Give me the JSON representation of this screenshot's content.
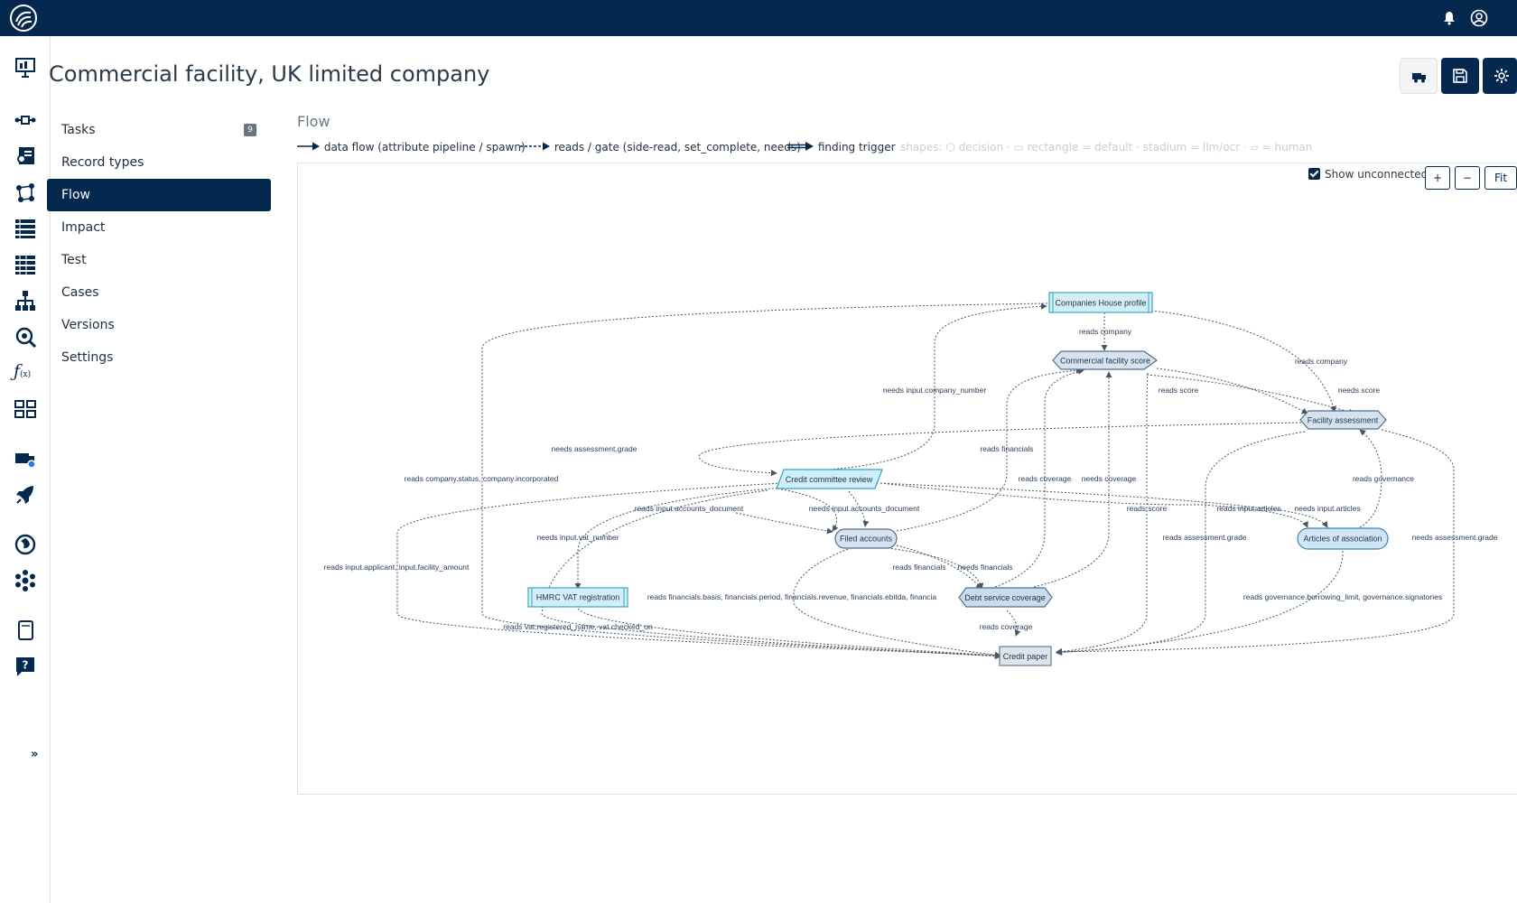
{
  "header": {
    "notifications_icon": "bell-icon",
    "user_icon": "user-circle-icon"
  },
  "rail": {
    "items": [
      "presentation-icon",
      "pipeline-icon",
      "contact-card-icon",
      "workflow-icon",
      "list-icon",
      "list-alt-icon",
      "hierarchy-icon",
      "inspect-icon",
      "function-icon",
      "table-icon",
      "truck-icon",
      "rocket-icon",
      "globe-icon",
      "network-icon",
      "document-icon",
      "help-icon"
    ],
    "expand_label": "»"
  },
  "page": {
    "title": "Commercial facility, UK limited company"
  },
  "toolbar": {
    "buttons": [
      "truck-icon",
      "save-icon",
      "gear-icon"
    ]
  },
  "nav": {
    "items": [
      {
        "label": "Tasks",
        "count": "9"
      },
      {
        "label": "Record types"
      },
      {
        "label": "Flow",
        "active": true
      },
      {
        "label": "Impact"
      },
      {
        "label": "Test"
      },
      {
        "label": "Cases"
      },
      {
        "label": "Versions"
      },
      {
        "label": "Settings"
      }
    ]
  },
  "flow": {
    "title": "Flow",
    "legend": {
      "data_flow": "data flow (attribute pipeline / spawn)",
      "reads_gate": "reads / gate (side-read, set_complete, needs)",
      "finding_trigger": "finding trigger",
      "shapes": "shapes: ⬡ decision · ▭ rectangle = default · stadium = llm/ocr · ▱ = human"
    },
    "show_unconnected": "Show unconnected",
    "zoom_in": "+",
    "zoom_out": "−",
    "fit": "Fit",
    "nodes": {
      "companies_house": "Companies House profile",
      "commercial_score": "Commercial facility score",
      "facility_assessment": "Facility assessment",
      "credit_committee": "Credit committee review",
      "filed_accounts": "Filed accounts",
      "articles": "Articles of association",
      "hmrc_vat": "HMRC VAT registration",
      "debt_service": "Debt service coverage",
      "credit_paper": "Credit paper"
    },
    "edge_labels": {
      "reads_company_1": "reads company",
      "reads_company_2": "reads company",
      "needs_company_number": "needs input.company_number",
      "reads_score": "reads score",
      "needs_score": "needs score",
      "needs_grade_1": "needs assessment.grade",
      "reads_financials_1": "reads financials",
      "reads_status": "reads company.status, company.incorporated",
      "reads_coverage_1": "reads coverage",
      "needs_coverage": "needs coverage",
      "reads_governance": "reads governance",
      "reads_accounts_doc": "reads input.accounts_document",
      "needs_accounts_doc": "needs input.accounts_document",
      "reads_score_2": "reads score",
      "reads_articles": "reads input.articles",
      "needs_articles": "needs input.articles",
      "needs_vat": "needs input.vat_number",
      "reads_grade": "reads assessment.grade",
      "needs_grade_2": "needs assessment.grade",
      "reads_applicant": "reads input.applicant, input.facility_amount",
      "reads_financials_2": "reads financials",
      "needs_financials": "needs financials",
      "reads_fin_basis": "reads financials.basis, financials.period, financials.revenue, financials.ebitda, financia",
      "reads_governance_limit": "reads governance.borrowing_limit, governance.signatories",
      "reads_vat": "reads vat.registered_name, vat.checked_on",
      "reads_coverage_2": "reads coverage"
    }
  }
}
